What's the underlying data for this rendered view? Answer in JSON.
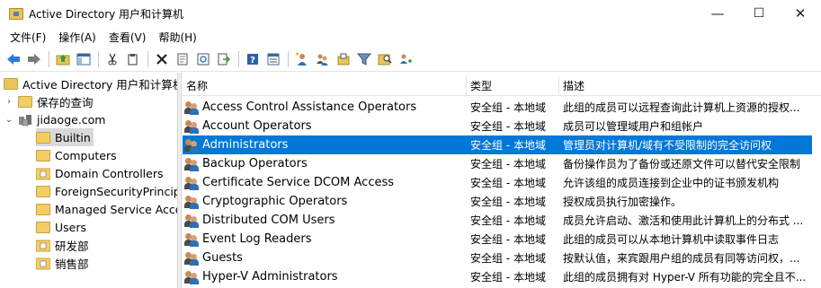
{
  "window": {
    "title": "Active Directory 用户和计算机",
    "minimize": "—",
    "maximize": "☐",
    "close": "✕"
  },
  "menu": [
    {
      "label": "文件(F)"
    },
    {
      "label": "操作(A)"
    },
    {
      "label": "查看(V)"
    },
    {
      "label": "帮助(H)"
    }
  ],
  "toolbar": {
    "icons": [
      "back-icon",
      "forward-icon",
      "sep",
      "up-folder-icon",
      "show-tree-icon",
      "sep",
      "cut-icon",
      "copy-icon",
      "sep",
      "delete-icon",
      "properties-icon",
      "refresh-icon",
      "export-icon",
      "sep",
      "help-icon",
      "details-icon",
      "sep",
      "new-user-icon",
      "new-group-icon",
      "new-ou-icon",
      "filter-icon",
      "find-icon",
      "add-to-group-icon"
    ]
  },
  "tree": [
    {
      "label": "Active Directory 用户和计算机",
      "level": 0,
      "arrow": "",
      "icon": "ad-root-icon"
    },
    {
      "label": "保存的查询",
      "level": 1,
      "arrow": "›",
      "icon": "folder-icon"
    },
    {
      "label": "jidaoge.com",
      "level": 1,
      "arrow": "⌄",
      "icon": "domain-icon"
    },
    {
      "label": "Builtin",
      "level": 2,
      "arrow": "",
      "icon": "folder-icon",
      "selected": true
    },
    {
      "label": "Computers",
      "level": 2,
      "arrow": "",
      "icon": "folder-icon"
    },
    {
      "label": "Domain Controllers",
      "level": 2,
      "arrow": "",
      "icon": "ou-icon"
    },
    {
      "label": "ForeignSecurityPrincipals",
      "level": 2,
      "arrow": "",
      "icon": "folder-icon"
    },
    {
      "label": "Managed Service Accounts",
      "level": 2,
      "arrow": "",
      "icon": "folder-icon"
    },
    {
      "label": "Users",
      "level": 2,
      "arrow": "",
      "icon": "folder-icon"
    },
    {
      "label": "研发部",
      "level": 2,
      "arrow": "",
      "icon": "ou-icon"
    },
    {
      "label": "销售部",
      "level": 2,
      "arrow": "",
      "icon": "ou-icon"
    }
  ],
  "columns": {
    "name": "名称",
    "type": "类型",
    "desc": "描述"
  },
  "rows": [
    {
      "name": "Access Control Assistance Operators",
      "type": "安全组 - 本地域",
      "desc": "此组的成员可以远程查询此计算机上资源的授权..."
    },
    {
      "name": "Account Operators",
      "type": "安全组 - 本地域",
      "desc": "成员可以管理域用户和组帐户"
    },
    {
      "name": "Administrators",
      "type": "安全组 - 本地域",
      "desc": "管理员对计算机/域有不受限制的完全访问权",
      "selected": true
    },
    {
      "name": "Backup Operators",
      "type": "安全组 - 本地域",
      "desc": "备份操作员为了备份或还原文件可以替代安全限制"
    },
    {
      "name": "Certificate Service DCOM Access",
      "type": "安全组 - 本地域",
      "desc": "允许该组的成员连接到企业中的证书颁发机构"
    },
    {
      "name": "Cryptographic Operators",
      "type": "安全组 - 本地域",
      "desc": "授权成员执行加密操作。"
    },
    {
      "name": "Distributed COM Users",
      "type": "安全组 - 本地域",
      "desc": "成员允许启动、激活和使用此计算机上的分布式 ..."
    },
    {
      "name": "Event Log Readers",
      "type": "安全组 - 本地域",
      "desc": "此组的成员可以从本地计算机中读取事件日志"
    },
    {
      "name": "Guests",
      "type": "安全组 - 本地域",
      "desc": "按默认值，来宾跟用户组的成员有同等访问权，..."
    },
    {
      "name": "Hyper-V Administrators",
      "type": "安全组 - 本地域",
      "desc": "此组的成员拥有对 Hyper-V 所有功能的完全且不..."
    }
  ]
}
